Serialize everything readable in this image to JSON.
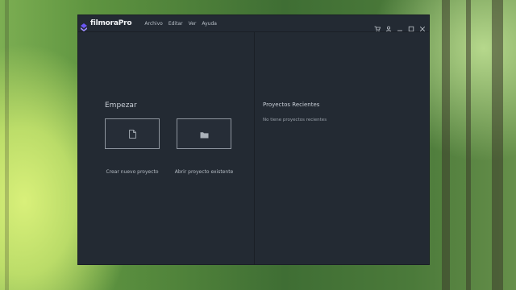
{
  "app": {
    "logo_text": "filmoraPro",
    "menu": [
      "Archivo",
      "Editar",
      "Ver",
      "Ayuda"
    ]
  },
  "window_controls": [
    "cart-icon",
    "user-icon",
    "minimize-icon",
    "maximize-icon",
    "close-icon"
  ],
  "start": {
    "heading": "Empezar",
    "new_project_label": "Crear nuevo proyecto",
    "open_project_label": "Abrir proyecto existente"
  },
  "recent": {
    "heading": "Proyectos Recientes",
    "empty_text": "No tiene proyectos recientes"
  },
  "colors": {
    "window_bg": "#232a33",
    "logo_accent": "#6b57f5",
    "text": "#c8ced6"
  }
}
